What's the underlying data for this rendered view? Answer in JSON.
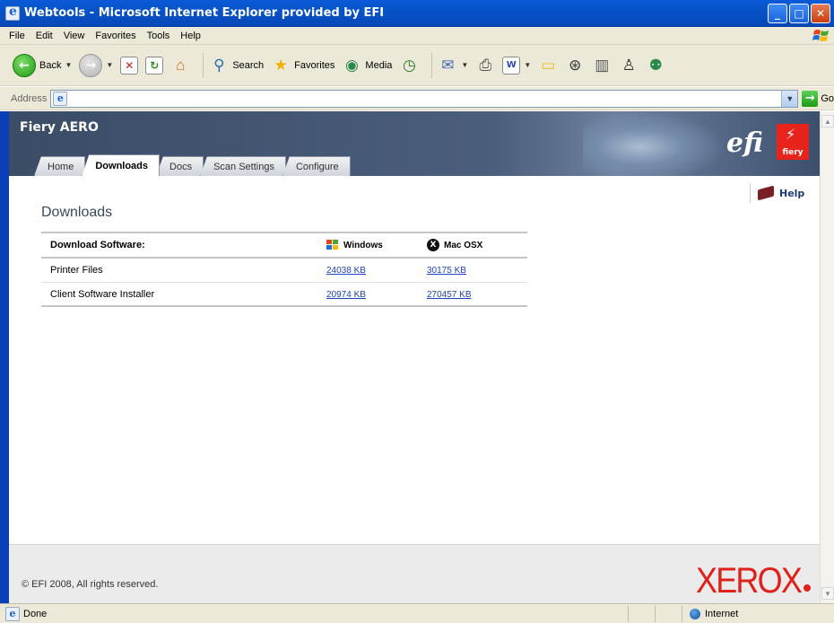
{
  "window": {
    "title": "Webtools - Microsoft Internet Explorer provided by EFI"
  },
  "menubar": {
    "items": [
      "File",
      "Edit",
      "View",
      "Favorites",
      "Tools",
      "Help"
    ]
  },
  "toolbar": {
    "back_label": "Back",
    "search_label": "Search",
    "favorites_label": "Favorites",
    "media_label": "Media"
  },
  "address": {
    "label": "Address",
    "value": "",
    "go_label": "Go"
  },
  "banner": {
    "title": "Fiery AERO",
    "efi": "efi",
    "fiery": "fiery"
  },
  "tabs": [
    {
      "label": "Home",
      "active": false
    },
    {
      "label": "Downloads",
      "active": true
    },
    {
      "label": "Docs",
      "active": false
    },
    {
      "label": "Scan Settings",
      "active": false
    },
    {
      "label": "Configure",
      "active": false
    }
  ],
  "help": {
    "label": "Help"
  },
  "downloads": {
    "title": "Downloads",
    "header": {
      "name": "Download Software:",
      "windows": "Windows",
      "mac": "Mac OSX"
    },
    "rows": [
      {
        "name": "Printer Files",
        "windows": "24038 KB",
        "mac": "30175 KB"
      },
      {
        "name": "Client Software Installer",
        "windows": "20974 KB",
        "mac": "270457 KB"
      }
    ]
  },
  "footer": {
    "copyright": "© EFI 2008, All rights reserved.",
    "brand": "XEROX"
  },
  "status": {
    "text": "Done",
    "zone": "Internet"
  },
  "colors": {
    "accent": "#0a5bd8",
    "brand_red": "#e0201b",
    "link": "#1f44b8",
    "banner": "#3a4c66"
  }
}
